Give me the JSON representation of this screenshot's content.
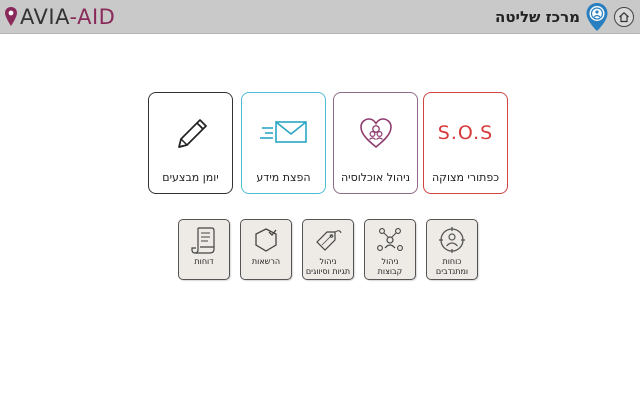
{
  "header": {
    "logo_text_prefix": "AVIA",
    "logo_text_suffix": "-AID",
    "title": "מרכז שליטה",
    "icons": {
      "home": "home-icon",
      "location": "location-pin-icon"
    }
  },
  "tiles": [
    {
      "label": "כפתורי מצוקה",
      "icon_text": "S.O.S",
      "icon": "sos-icon",
      "color": "#d04444"
    },
    {
      "label": "ניהול אוכלוסיה",
      "icon": "heart-people-icon",
      "color": "#8d6b89"
    },
    {
      "label": "הפצת מידע",
      "icon": "envelope-icon",
      "color": "#4fbcd4"
    },
    {
      "label": "יומן מבצעים",
      "icon": "pencil-icon",
      "color": "#333333"
    }
  ],
  "small_tiles": [
    {
      "label_line1": "כוחות",
      "label_line2": "ומתנדבים",
      "icon": "person-target-icon"
    },
    {
      "label_line1": "ניהול",
      "label_line2": "קבוצות",
      "icon": "group-icon"
    },
    {
      "label_line1": "ניהול",
      "label_line2": "תגיות וסיווגים",
      "icon": "tags-icon"
    },
    {
      "label_line1": "הרשאות",
      "label_line2": "",
      "icon": "permissions-shield-icon"
    },
    {
      "label_line1": "דוחות",
      "label_line2": "",
      "icon": "report-scroll-icon"
    }
  ]
}
